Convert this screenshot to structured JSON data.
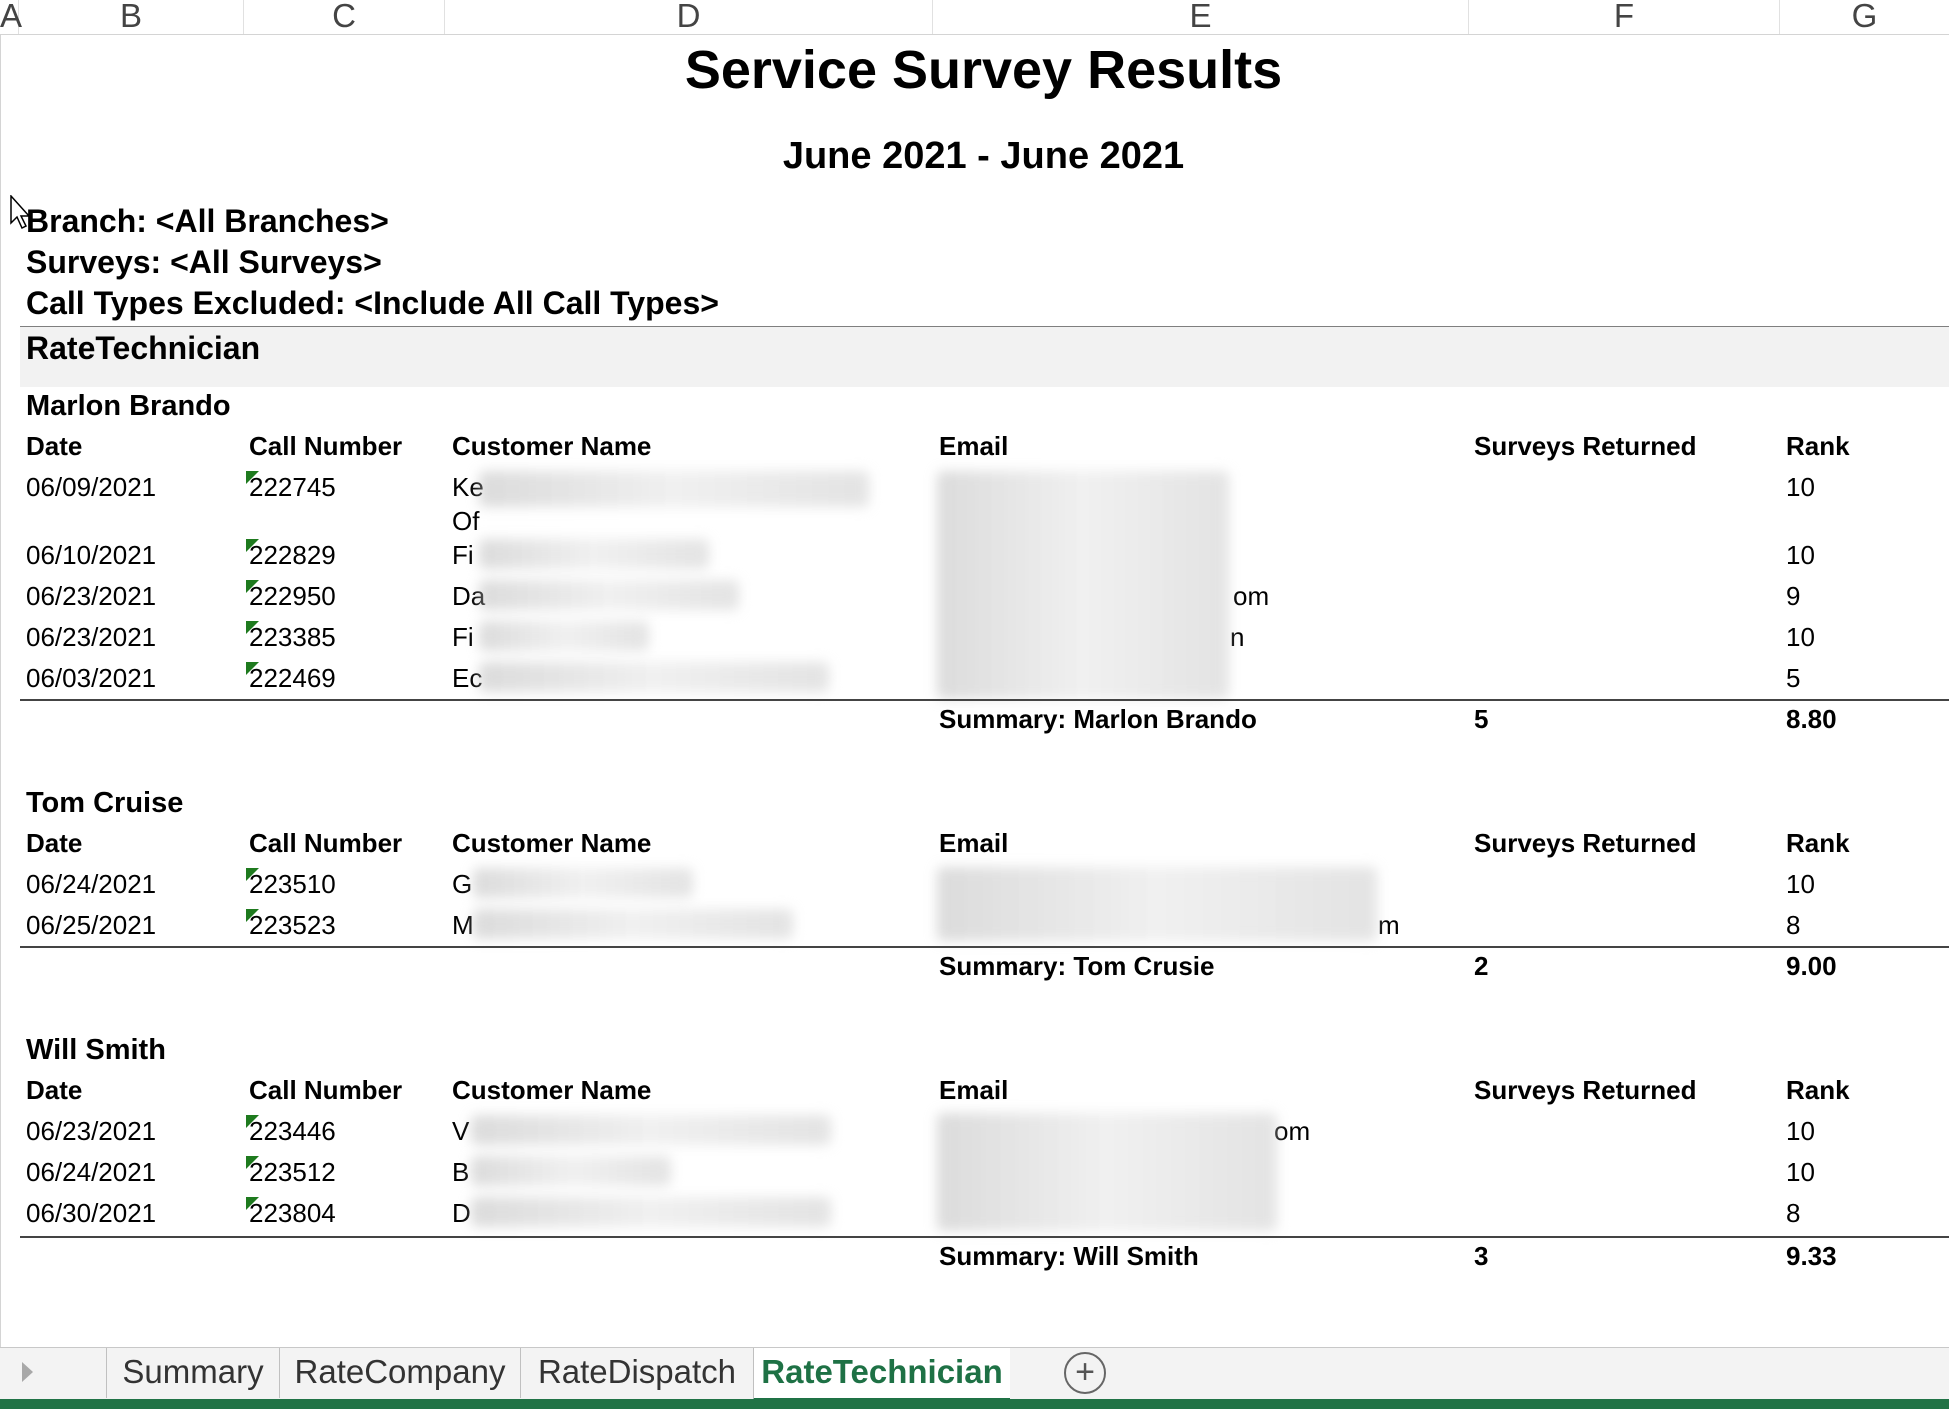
{
  "columns": [
    "A",
    "B",
    "C",
    "D",
    "E",
    "F",
    "G"
  ],
  "report": {
    "title": "Service Survey Results",
    "period": "June 2021 - June 2021",
    "branch": "Branch: <All Branches>",
    "surveys": "Surveys: <All Surveys>",
    "call_types": "Call Types Excluded:  <Include All Call Types>",
    "section": "RateTechnician"
  },
  "headers": {
    "date": "Date",
    "call_number": "Call Number",
    "customer_name": "Customer Name",
    "email": "Email",
    "surveys_returned": "Surveys Returned",
    "rank": "Rank"
  },
  "technicians": [
    {
      "name": "Marlon Brando",
      "rows": [
        {
          "date": "06/09/2021",
          "call": "222745",
          "customer": "Ke",
          "customer2": "Of",
          "email": "",
          "rank": "10"
        },
        {
          "date": "06/10/2021",
          "call": "222829",
          "customer": "Fi",
          "email": "",
          "rank": "10"
        },
        {
          "date": "06/23/2021",
          "call": "222950",
          "customer": "Da",
          "email": "om",
          "rank": "9"
        },
        {
          "date": "06/23/2021",
          "call": "223385",
          "customer": "Fi",
          "email": "n",
          "rank": "10"
        },
        {
          "date": "06/03/2021",
          "call": "222469",
          "customer": "Ec",
          "email": "",
          "rank": "5"
        }
      ],
      "summary_label": "Summary:  Marlon Brando",
      "surveys_returned": "5",
      "avg_rank": "8.80"
    },
    {
      "name": "Tom Cruise",
      "rows": [
        {
          "date": "06/24/2021",
          "call": "223510",
          "customer": "G",
          "email": "",
          "rank": "10"
        },
        {
          "date": "06/25/2021",
          "call": "223523",
          "customer": "M",
          "email": "m",
          "rank": "8"
        }
      ],
      "summary_label": "Summary:  Tom Crusie",
      "surveys_returned": "2",
      "avg_rank": "9.00"
    },
    {
      "name": "Will Smith",
      "rows": [
        {
          "date": "06/23/2021",
          "call": "223446",
          "customer": "V",
          "email": "om",
          "rank": "10"
        },
        {
          "date": "06/24/2021",
          "call": "223512",
          "customer": "B",
          "email": "",
          "rank": "10"
        },
        {
          "date": "06/30/2021",
          "call": "223804",
          "customer": "D",
          "email": "",
          "rank": "8"
        }
      ],
      "summary_label": "Summary:  Will Smith",
      "surveys_returned": "3",
      "avg_rank": "9.33"
    }
  ],
  "tabs": [
    "Summary",
    "RateCompany",
    "RateDispatch",
    "RateTechnician"
  ],
  "active_tab": "RateTechnician",
  "colors": {
    "accent": "#1e7145",
    "status_bar": "#217346",
    "comment_marker": "#1e7a1e"
  }
}
